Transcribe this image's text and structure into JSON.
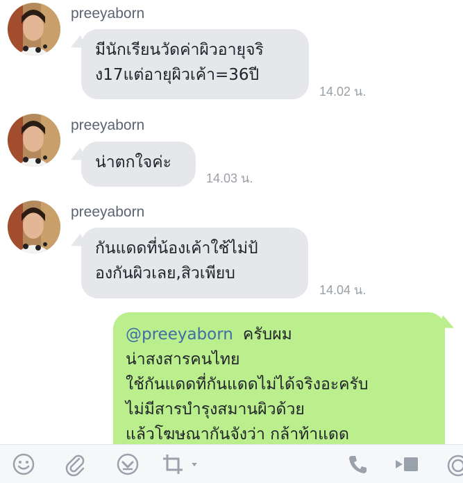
{
  "messages": [
    {
      "sender": "preeyaborn",
      "lines": [
        "มีนักเรียนวัดค่าผิวอายุจริ",
        "ง17แต่อายุผิวเค้า=36ปี"
      ],
      "time": "14.02 น."
    },
    {
      "sender": "preeyaborn",
      "lines": [
        "น่าตกใจค่ะ"
      ],
      "time": "14.03 น."
    },
    {
      "sender": "preeyaborn",
      "lines": [
        "กันแดดที่น้องเค้าใช้ไม่ป้",
        "องกันผิวเลย,สิวเพียบ"
      ],
      "time": "14.04 น."
    }
  ],
  "outgoing": {
    "mention": "@preeyaborn",
    "lines": [
      "ครับผม",
      "น่าสงสารคนไทย",
      "ใช้กันแดดที่กันแดดไม่ได้จริงอะครับ",
      "ไม่มีสารบำรุงสมานผิวด้วย",
      "แล้วโฆษณากันจังว่า กล้าท้าแดด"
    ]
  },
  "toolbar": {
    "icons": [
      "emoji-icon",
      "attachment-icon",
      "download-icon",
      "crop-icon",
      "phone-icon",
      "video-icon",
      "voice-icon"
    ]
  }
}
